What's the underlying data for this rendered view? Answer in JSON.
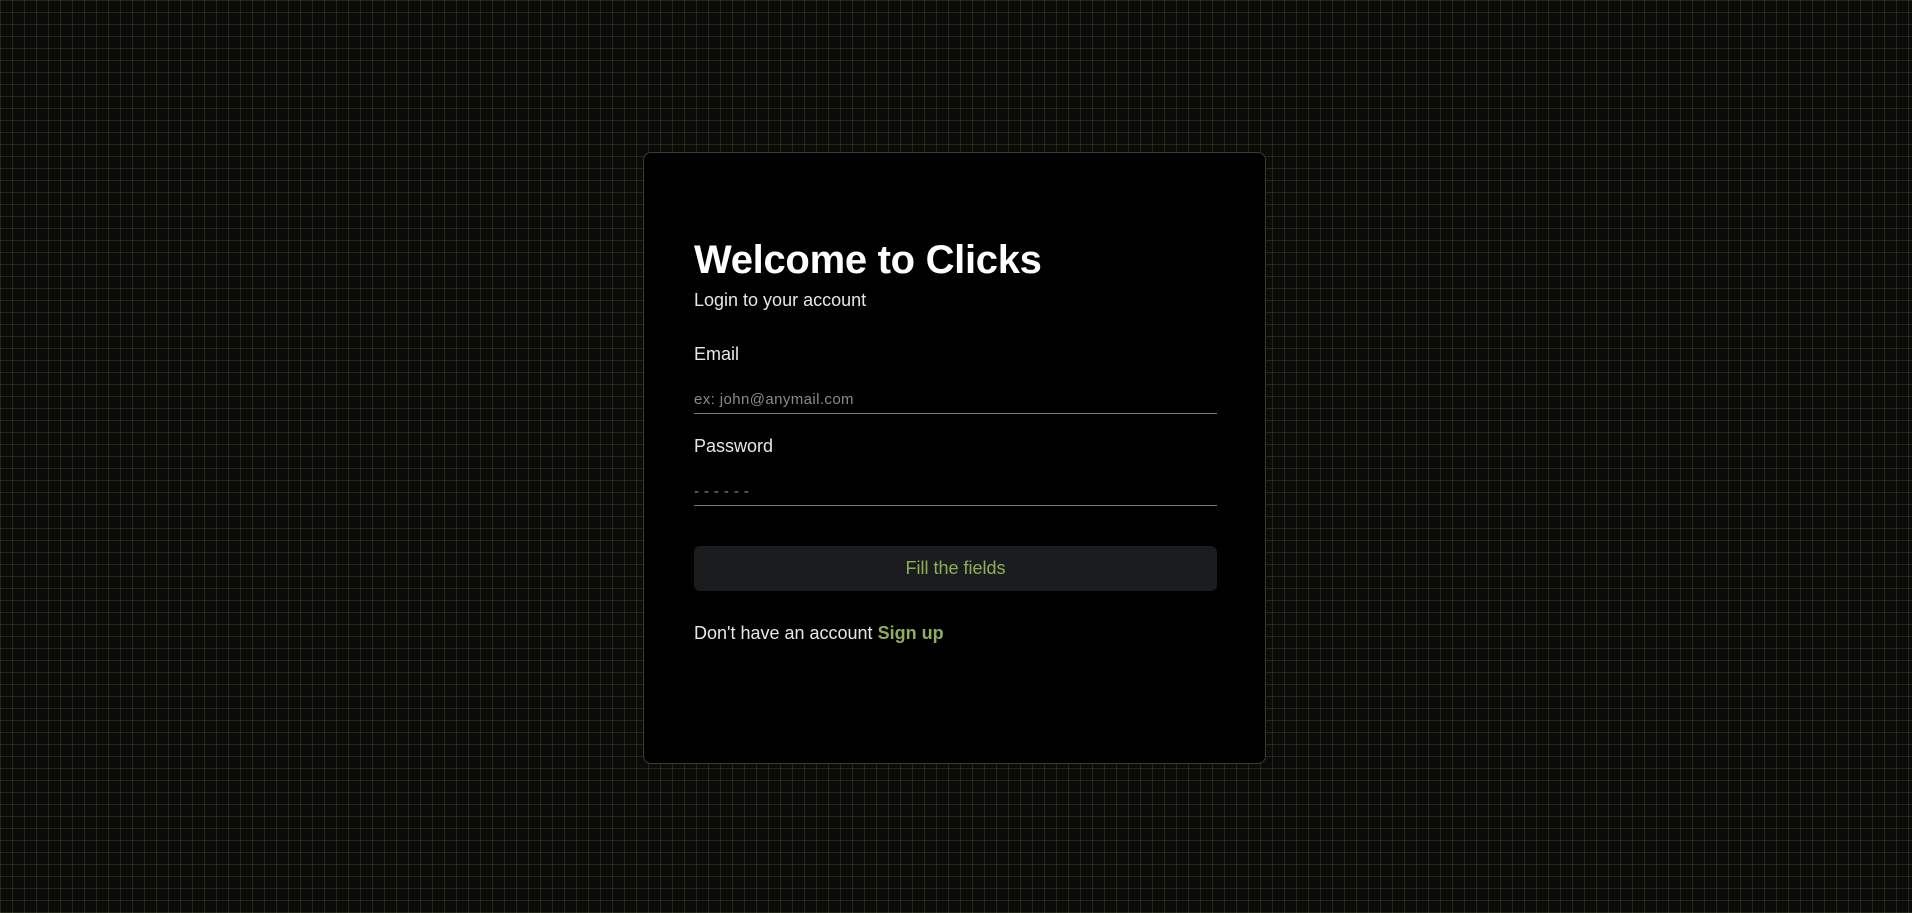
{
  "login_card": {
    "title": "Welcome to Clicks",
    "subtitle": "Login to your account",
    "email": {
      "label": "Email",
      "placeholder": "ex: john@anymail.com",
      "value": ""
    },
    "password": {
      "label": "Password",
      "placeholder": "- - - - - -",
      "value": ""
    },
    "submit_label": "Fill the fields",
    "signup_prompt": "Don't have an account",
    "signup_link": "Sign up"
  },
  "colors": {
    "background": "#0b0b09",
    "grid": "#4a5530",
    "card": "#000000",
    "accent": "#8eae5a",
    "button_bg": "#1b1c1e"
  }
}
